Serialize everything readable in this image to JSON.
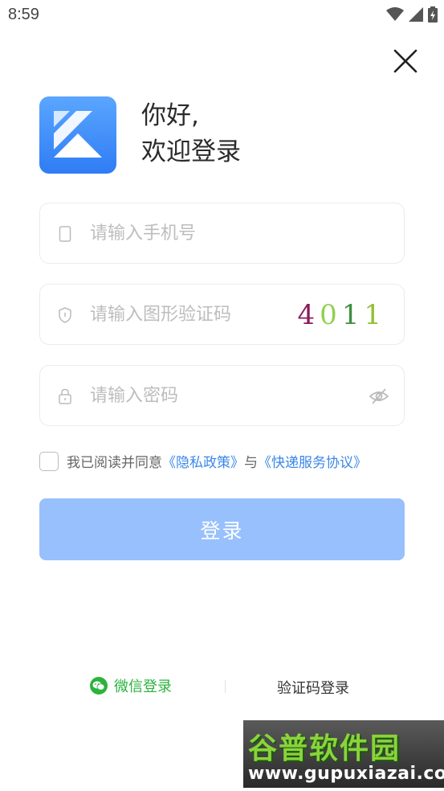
{
  "status_bar": {
    "time": "8:59"
  },
  "greeting": {
    "line1": "你好,",
    "line2": "欢迎登录"
  },
  "phone": {
    "placeholder": "请输入手机号"
  },
  "captcha": {
    "placeholder": "请输入图形验证码",
    "chars": [
      "4",
      "0",
      "1",
      "1"
    ],
    "colors": [
      "#8a1c5a",
      "#8fd14f",
      "#3f8f3f",
      "#8fbf30"
    ]
  },
  "password": {
    "placeholder": "请输入密码"
  },
  "agreement": {
    "prefix": "我已阅读并同意",
    "privacy": "《隐私政策》",
    "and": "与",
    "service": "《快递服务协议》"
  },
  "login_button": {
    "label": "登录"
  },
  "alt_login": {
    "wechat": "微信登录",
    "sms": "验证码登录"
  },
  "watermark": {
    "title": "谷普软件园",
    "url": "www.gupuxiazai.com"
  },
  "colors": {
    "primary": "#3a87e8",
    "button_disabled": "#98c0fc",
    "wechat": "#2bb33c"
  }
}
